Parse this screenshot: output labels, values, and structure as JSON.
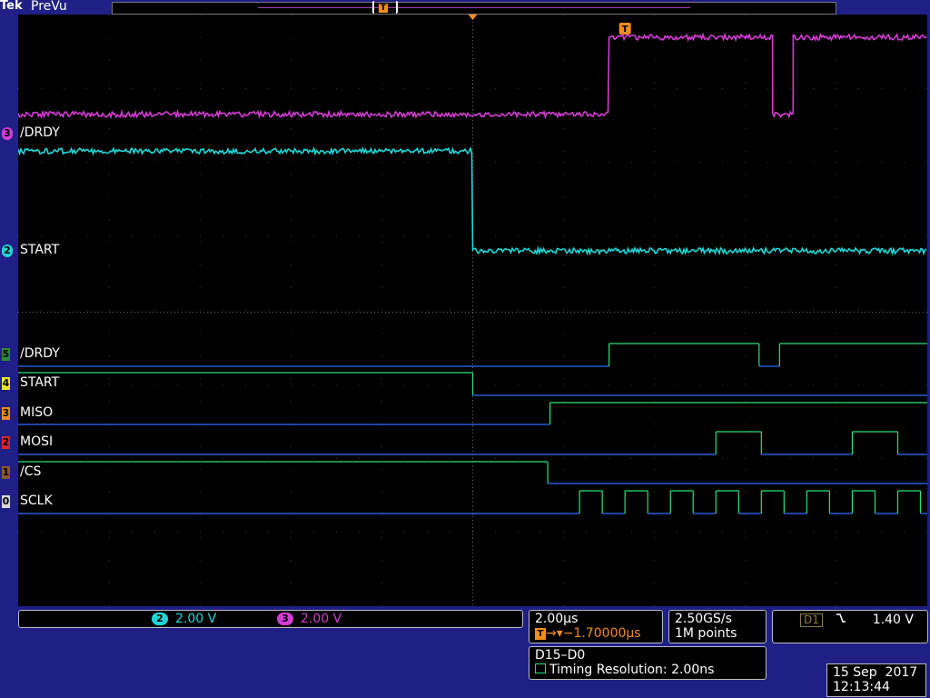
{
  "header": {
    "brand": "Tek",
    "mode": "PreVu",
    "record_marker": "T"
  },
  "colors": {
    "ch2": "#1ed6d6",
    "ch3": "#d53cd5",
    "digital_high": "#2ee07a",
    "digital_low": "#2f6cff",
    "trigger": "#f28c1a",
    "screen_bg": "#1f1f86"
  },
  "waveform_labels": {
    "ch3": "/DRDY",
    "ch2": "START",
    "d5": "/DRDY",
    "d4": "START",
    "d3": "MISO",
    "d2": "MOSI",
    "d1": "/CS",
    "d0": "SCLK"
  },
  "channel_badges": {
    "ch3": "3",
    "ch2": "2",
    "d5": "5",
    "d4": "4",
    "d3": "3",
    "d2": "2",
    "d1": "1",
    "d0": "0"
  },
  "vertical_scales": [
    {
      "badge": "2",
      "value": "2.00 V",
      "color": "#1ed6d6"
    },
    {
      "badge": "3",
      "value": "2.00 V",
      "color": "#d53cd5"
    }
  ],
  "horizontal": {
    "time_per_div": "2.00µs",
    "trigger_delay": "−1.70000µs",
    "trigger_badge": "T"
  },
  "acquisition": {
    "sample_rate": "2.50GS/s",
    "record_length": "1M points"
  },
  "trigger": {
    "source": "D1",
    "slope_icon": "falling-edge-icon",
    "level": "1.40 V"
  },
  "digital": {
    "group": "D15–D0",
    "timing_resolution": "Timing Resolution: 2.00ns"
  },
  "datetime": {
    "date": "15 Sep  2017",
    "time": "12:13:44"
  },
  "traces": {
    "time_range_us": [
      -11.7,
      8.3
    ],
    "ch3": [
      [
        -11.7,
        1
      ],
      [
        1.3,
        1
      ],
      [
        1.3,
        5.2
      ],
      [
        4.9,
        5.2
      ],
      [
        4.9,
        1
      ],
      [
        5.35,
        1
      ],
      [
        5.35,
        5.2
      ],
      [
        8.3,
        5.2
      ]
    ],
    "ch2": [
      [
        -11.7,
        3.8
      ],
      [
        -1.7,
        3.8
      ],
      [
        -1.7,
        0
      ],
      [
        8.3,
        0
      ]
    ],
    "d5": [
      [
        -11.7,
        0
      ],
      [
        1.3,
        0
      ],
      [
        1.3,
        1
      ],
      [
        4.6,
        1
      ],
      [
        4.6,
        0
      ],
      [
        5.05,
        0
      ],
      [
        5.05,
        1
      ],
      [
        8.3,
        1
      ]
    ],
    "d4": [
      [
        -11.7,
        1
      ],
      [
        -1.7,
        1
      ],
      [
        -1.7,
        0
      ],
      [
        8.3,
        0
      ]
    ],
    "d3": [
      [
        -11.7,
        0
      ],
      [
        0.0,
        0
      ],
      [
        0.0,
        1
      ],
      [
        8.3,
        1
      ]
    ],
    "d2": [
      [
        -11.7,
        0
      ],
      [
        3.65,
        0
      ],
      [
        3.65,
        1
      ],
      [
        4.65,
        1
      ],
      [
        4.65,
        0
      ],
      [
        6.65,
        0
      ],
      [
        6.65,
        1
      ],
      [
        7.65,
        1
      ],
      [
        7.65,
        0
      ],
      [
        8.3,
        0
      ]
    ],
    "d1": [
      [
        -11.7,
        1
      ],
      [
        -0.05,
        1
      ],
      [
        -0.05,
        0
      ],
      [
        8.3,
        0
      ]
    ],
    "d0": [
      [
        -11.7,
        0
      ],
      [
        0.65,
        0
      ],
      [
        0.65,
        1
      ],
      [
        1.15,
        1
      ],
      [
        1.15,
        0
      ],
      [
        1.65,
        0
      ],
      [
        1.65,
        1
      ],
      [
        2.15,
        1
      ],
      [
        2.15,
        0
      ],
      [
        2.65,
        0
      ],
      [
        2.65,
        1
      ],
      [
        3.15,
        1
      ],
      [
        3.15,
        0
      ],
      [
        3.65,
        0
      ],
      [
        3.65,
        1
      ],
      [
        4.15,
        1
      ],
      [
        4.15,
        0
      ],
      [
        4.65,
        0
      ],
      [
        4.65,
        1
      ],
      [
        5.15,
        1
      ],
      [
        5.15,
        0
      ],
      [
        5.65,
        0
      ],
      [
        5.65,
        1
      ],
      [
        6.15,
        1
      ],
      [
        6.15,
        0
      ],
      [
        6.65,
        0
      ],
      [
        6.65,
        1
      ],
      [
        7.15,
        1
      ],
      [
        7.15,
        0
      ],
      [
        7.65,
        0
      ],
      [
        7.65,
        1
      ],
      [
        8.15,
        1
      ],
      [
        8.15,
        0
      ],
      [
        8.3,
        0
      ]
    ]
  }
}
